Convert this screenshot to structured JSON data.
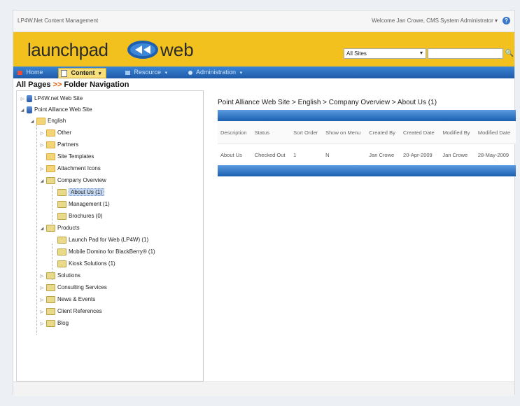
{
  "app_title": "LP4W.Net Content Management",
  "welcome_text": "Welcome Jan Crowe, CMS System Administrator ▾",
  "logo": {
    "left": "launchpad",
    "right": "web"
  },
  "site_select": {
    "value": "All Sites"
  },
  "search": {
    "placeholder": ""
  },
  "nav": {
    "items": [
      {
        "label": "Home"
      },
      {
        "label": "Content"
      },
      {
        "label": "Resource"
      },
      {
        "label": "Administration"
      }
    ]
  },
  "page_heading": {
    "left": "All Pages",
    "sep": ">>",
    "right": "Folder Navigation"
  },
  "tree": [
    {
      "label": "LP4W.net Web Site"
    },
    {
      "label": "Point Alliance Web Site"
    },
    {
      "label": "English"
    },
    {
      "label": "Other"
    },
    {
      "label": "Partners"
    },
    {
      "label": "Site Templates"
    },
    {
      "label": "Attachment Icons"
    },
    {
      "label": "Company Overview"
    },
    {
      "label": "About Us (1)"
    },
    {
      "label": "Management (1)"
    },
    {
      "label": "Brochures (0)"
    },
    {
      "label": "Products"
    },
    {
      "label": "Launch Pad for Web (LP4W) (1)"
    },
    {
      "label": "Mobile Domino for BlackBerry® (1)"
    },
    {
      "label": "Kiosk Solutions (1)"
    },
    {
      "label": "Solutions"
    },
    {
      "label": "Consulting Services"
    },
    {
      "label": "News & Events"
    },
    {
      "label": "Client References"
    },
    {
      "label": "Blog"
    }
  ],
  "breadcrumb": "Point Alliance Web Site > English > Company Overview > About Us (1)",
  "table": {
    "columns": [
      "Description",
      "Status",
      "Sort Order",
      "Show on Menu",
      "Created By",
      "Created Date",
      "Modified By",
      "Modified Date"
    ],
    "rows": [
      [
        "About Us",
        "Checked Out",
        "1",
        "N",
        "Jan Crowe",
        "20-Apr-2009",
        "Jan Crowe",
        "28-May-2009"
      ]
    ]
  }
}
